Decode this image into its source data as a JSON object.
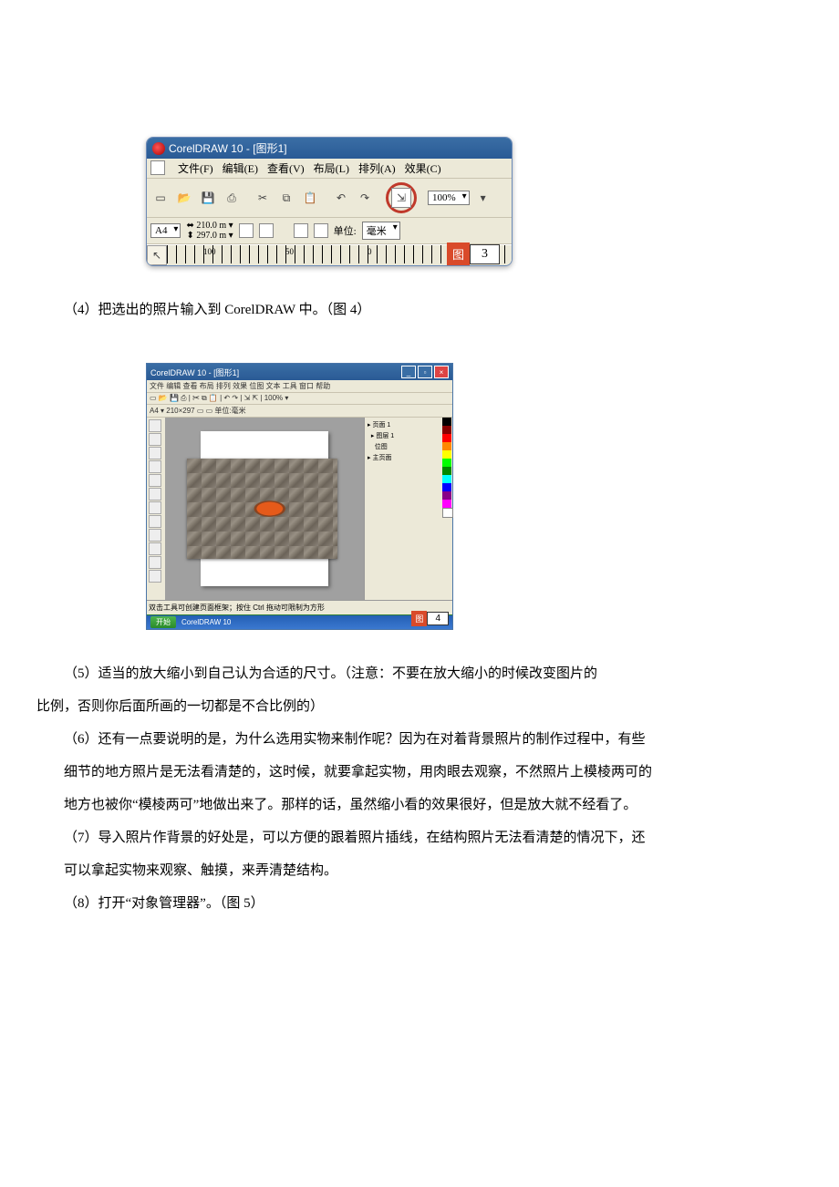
{
  "fig3": {
    "title": "CorelDRAW 10 - [图形1]",
    "menu": [
      "文件(F)",
      "编辑(E)",
      "查看(V)",
      "布局(L)",
      "排列(A)",
      "效果(C)"
    ],
    "zoom": "100%",
    "paper": "A4",
    "dim_w": "210.0 m",
    "dim_h": "297.0 m",
    "units_label": "单位:",
    "units_value": "毫米",
    "ruler_marks": {
      "m100": "100",
      "m50": "50",
      "m0": "0"
    },
    "label_text": "图",
    "label_num": "3"
  },
  "caption4": "（4）把选出的照片输入到 CorelDRAW 中。（图 4）",
  "fig4": {
    "title": "CorelDRAW 10 - [图形1]",
    "label_text": "图",
    "label_num": "4"
  },
  "paragraphs": {
    "p5a": "（5）适当的放大缩小到自己认为合适的尺寸。（注意：不要在放大缩小的时候改变图片的",
    "p5b": "比例，否则你后面所画的一切都是不合比例的）",
    "p6a": "（6）还有一点要说明的是，为什么选用实物来制作呢？因为在对着背景照片的制作过程中，有些",
    "p6b": "细节的地方照片是无法看清楚的，这时候，就要拿起实物，用肉眼去观察，不然照片上模棱两可的",
    "p6c": "地方也被你“模棱两可”地做出来了。那样的话，虽然缩小看的效果很好，但是放大就不经看了。",
    "p7a": "（7）导入照片作背景的好处是，可以方便的跟着照片插线，在结构照片无法看清楚的情况下，还",
    "p7b": "可以拿起实物来观察、触摸，来弄清楚结构。",
    "p8": "（8）打开“对象管理器”。（图 5）"
  }
}
